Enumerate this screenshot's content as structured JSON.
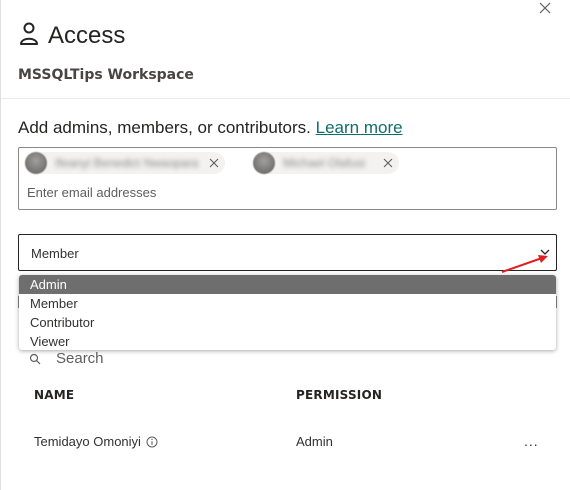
{
  "panel": {
    "title": "Access",
    "workspace_name": "MSSQLTips Workspace",
    "close_icon": "close-icon",
    "title_icon": "person-icon"
  },
  "add_section": {
    "prompt": "Add admins, members, or contributors.",
    "learn_more": "Learn more",
    "chips": [
      {
        "name": "Ifeanyi Benedict Nwaopara",
        "blurred": true
      },
      {
        "name": "Michael Olafusi",
        "blurred": true
      }
    ],
    "email_placeholder": "Enter email addresses"
  },
  "permission_select": {
    "value": "Member",
    "options": [
      "Admin",
      "Member",
      "Contributor",
      "Viewer"
    ],
    "highlighted": "Admin"
  },
  "search": {
    "placeholder": "Search"
  },
  "table": {
    "headers": [
      "NAME",
      "PERMISSION"
    ],
    "rows": [
      {
        "name": "Temidayo Omoniyi",
        "permission": "Admin",
        "more": "..."
      }
    ]
  },
  "colors": {
    "accent_link": "#106d6e",
    "annotation_arrow": "#e02020",
    "selected_option": "#6e6e6e"
  }
}
